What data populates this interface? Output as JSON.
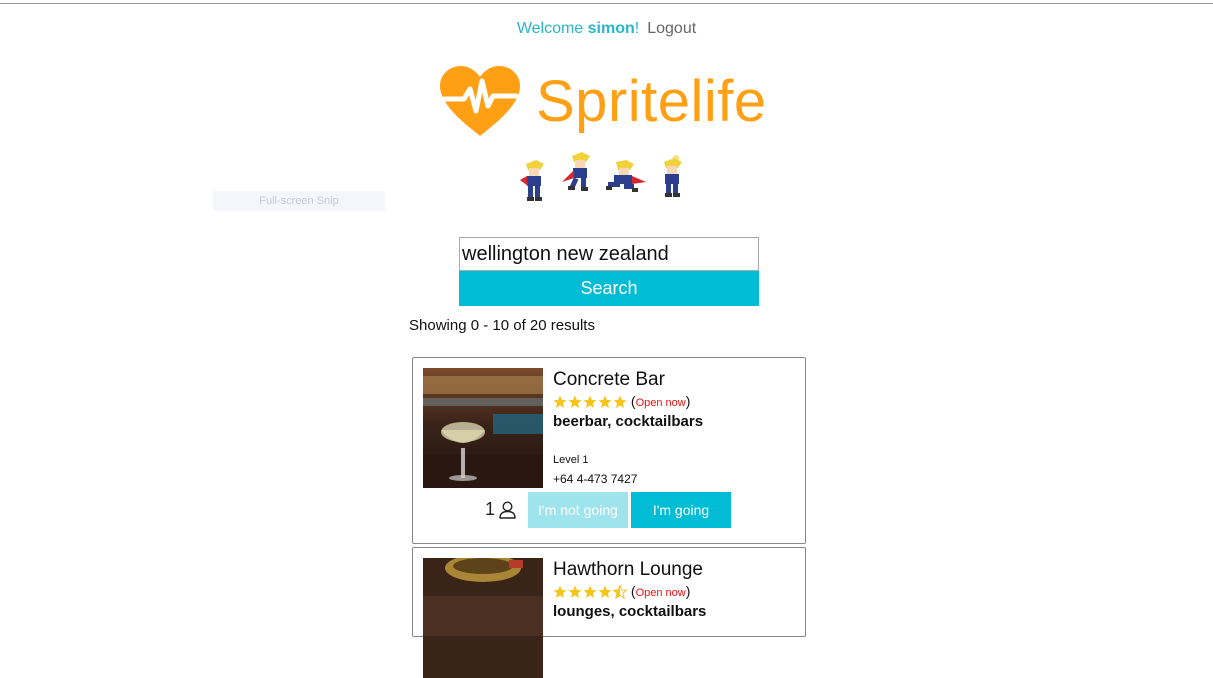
{
  "header": {
    "welcome_prefix": "Welcome ",
    "username": "simon",
    "welcome_suffix": "!",
    "logout_label": "Logout"
  },
  "brand": {
    "name": "Spritelife",
    "color": "#ff9f14",
    "icon": "heart-pulse-icon"
  },
  "overlay": {
    "label": "Full-screen Snip"
  },
  "search": {
    "value": "wellington new zealand",
    "button_label": "Search",
    "accent": "#00bcd4"
  },
  "results": {
    "summary": "Showing 0 - 10 of 20 results",
    "items": [
      {
        "name": "Concrete Bar",
        "rating": 5,
        "status": "Open now",
        "categories": "beerbar, cocktailbars",
        "address": "Level 1",
        "phone": "+64 4-473 7427",
        "going_count": "1",
        "not_going_label": "I'm not going",
        "going_label": "I'm going"
      },
      {
        "name": "Hawthorn Lounge",
        "rating": 4.5,
        "status": "Open now",
        "categories": "lounges, cocktailbars"
      }
    ]
  }
}
